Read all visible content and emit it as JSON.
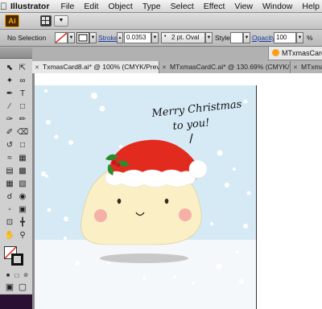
{
  "menubar": {
    "app_name": "Illustrator",
    "items": [
      "File",
      "Edit",
      "Object",
      "Type",
      "Select",
      "Effect",
      "View",
      "Window",
      "Help"
    ]
  },
  "appbar": {
    "logo_text": "Ai",
    "arrange_label": "▼"
  },
  "control_panel": {
    "selection_status": "No Selection",
    "stroke_label": "Stroke",
    "stroke_value": "0.0353",
    "brush_value": "2 pt. Oval",
    "style_label": "Style:",
    "opacity_label": "Opacity",
    "opacity_value": "100",
    "opacity_unit": "%"
  },
  "window_title": "MTxmasCardC",
  "tabs": [
    {
      "label": "TxmasCard8.ai* @ 100% (CMYK/Preview)",
      "active": true
    },
    {
      "label": "MTxmasCardC.ai* @ 130.69% (CMYK/...",
      "active": false
    },
    {
      "label": "MTxmasCard",
      "active": false
    }
  ],
  "artwork": {
    "text_line1": "Merry Christmas",
    "text_line2": "to you!"
  },
  "colors": {
    "sky": "#d6eaf6",
    "snow_ground": "#f4f8fb",
    "body": "#fbefc6",
    "hat_red": "#e32a1e",
    "hat_white": "#ffffff",
    "cheek": "#f4a0a0",
    "holly": "#2d8a2d"
  }
}
